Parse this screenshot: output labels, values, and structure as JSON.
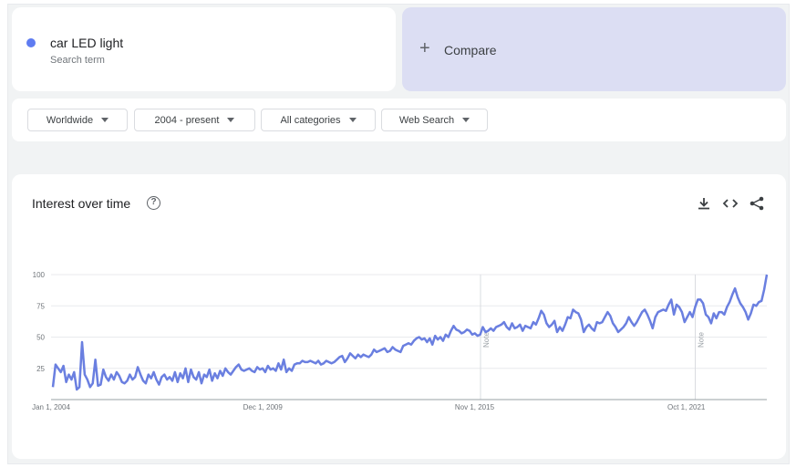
{
  "search_term": {
    "name": "car LED light",
    "subtitle": "Search term",
    "color": "#5f7cf1"
  },
  "compare": {
    "icon": "plus-icon",
    "label": "Compare"
  },
  "filters": {
    "region": "Worldwide",
    "time": "2004 - present",
    "category": "All categories",
    "search_type": "Web Search"
  },
  "chart_card": {
    "title": "Interest over time",
    "icons": [
      "help-icon",
      "download-icon",
      "embed-code-icon",
      "share-icon"
    ]
  },
  "chart_data": {
    "type": "line",
    "title": "Interest over time",
    "xlabel": "",
    "ylabel": "",
    "ylim": [
      0,
      100
    ],
    "y_ticks": [
      25,
      50,
      75,
      100
    ],
    "x_tick_labels": [
      {
        "label": "Jan 1, 2004",
        "x": "2004-01"
      },
      {
        "label": "Dec 1, 2009",
        "x": "2009-12"
      },
      {
        "label": "Nov 1, 2015",
        "x": "2015-11"
      },
      {
        "label": "Oct 1, 2021",
        "x": "2021-10"
      }
    ],
    "annotations": [
      {
        "label": "Note",
        "x": "2016-01"
      },
      {
        "label": "Note",
        "x": "2022-01"
      }
    ],
    "grid": true,
    "legend": "none",
    "x_start": "2004-01",
    "x_end": "2024-01",
    "series": [
      {
        "color": "#6a7fe0",
        "values": [
          10,
          28,
          25,
          22,
          27,
          14,
          20,
          16,
          22,
          8,
          10,
          46,
          20,
          16,
          10,
          13,
          32,
          11,
          12,
          24,
          18,
          15,
          20,
          16,
          22,
          19,
          14,
          13,
          15,
          20,
          16,
          18,
          26,
          20,
          15,
          13,
          20,
          17,
          22,
          16,
          12,
          18,
          20,
          16,
          18,
          15,
          22,
          14,
          21,
          17,
          25,
          14,
          24,
          18,
          16,
          22,
          13,
          20,
          18,
          24,
          15,
          21,
          17,
          23,
          19,
          25,
          22,
          20,
          23,
          26,
          28,
          24,
          23,
          24,
          25,
          23,
          22,
          26,
          24,
          25,
          22,
          27,
          24,
          25,
          23,
          29,
          24,
          32,
          22,
          25,
          23,
          28,
          29,
          29,
          31,
          30,
          30,
          31,
          30,
          29,
          31,
          28,
          29,
          31,
          30,
          29,
          30,
          32,
          34,
          35,
          30,
          33,
          37,
          35,
          33,
          36,
          34,
          36,
          35,
          34,
          36,
          40,
          38,
          39,
          40,
          41,
          38,
          39,
          42,
          40,
          39,
          38,
          43,
          44,
          45,
          44,
          47,
          49,
          50,
          48,
          49,
          46,
          49,
          44,
          51,
          48,
          50,
          47,
          52,
          50,
          55,
          59,
          56,
          55,
          53,
          54,
          56,
          55,
          52,
          53,
          51,
          52,
          58,
          54,
          55,
          57,
          55,
          58,
          59,
          60,
          62,
          58,
          56,
          61,
          57,
          58,
          60,
          55,
          59,
          58,
          57,
          62,
          60,
          65,
          71,
          68,
          61,
          58,
          60,
          63,
          54,
          58,
          55,
          60,
          66,
          65,
          72,
          70,
          69,
          64,
          54,
          58,
          60,
          57,
          55,
          62,
          61,
          62,
          66,
          70,
          67,
          61,
          58,
          54,
          56,
          58,
          61,
          66,
          62,
          59,
          62,
          66,
          70,
          72,
          68,
          63,
          57,
          66,
          70,
          71,
          72,
          71,
          76,
          80,
          68,
          76,
          74,
          70,
          62,
          66,
          70,
          66,
          74,
          80,
          80,
          77,
          68,
          66,
          61,
          69,
          65,
          70,
          70,
          68,
          74,
          78,
          84,
          89,
          82,
          77,
          74,
          70,
          64,
          69,
          76,
          75,
          78,
          79,
          88,
          100
        ]
      }
    ]
  }
}
